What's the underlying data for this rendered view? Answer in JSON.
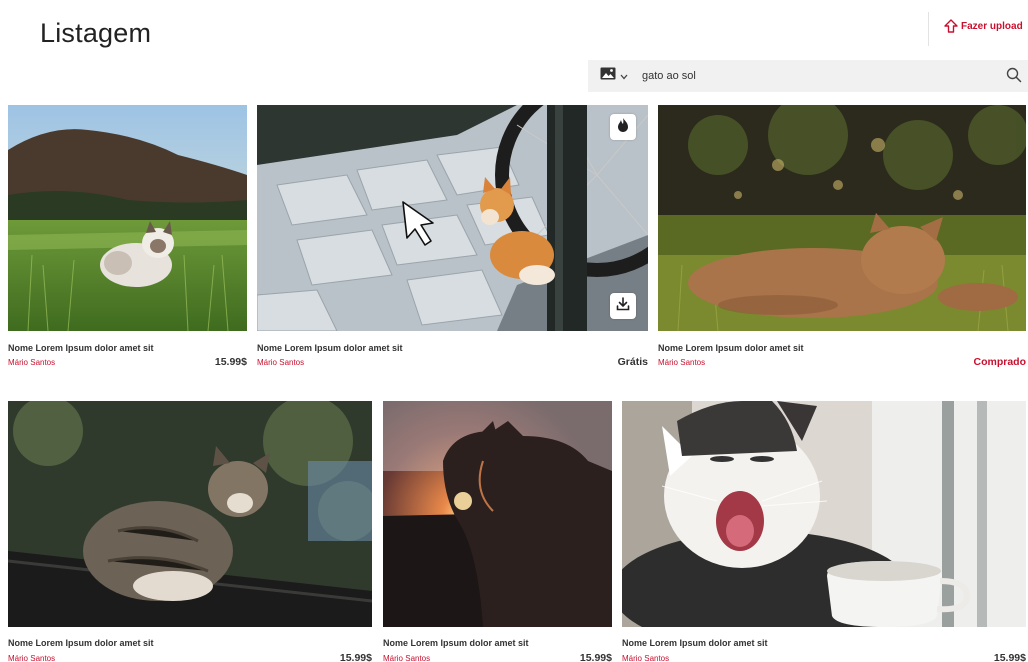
{
  "page": {
    "title": "Listagem"
  },
  "header": {
    "upload_label": "Fazer upload"
  },
  "search": {
    "query": "gato ao sol",
    "type_icon": "image-icon"
  },
  "colors": {
    "accent": "#c8102e",
    "search_bg": "#f1f1f1"
  },
  "items": [
    {
      "name": "Nome Lorem Ipsum dolor amet sit",
      "author": "Mário Santos",
      "price": "15.99$"
    },
    {
      "name": "Nome Lorem Ipsum dolor amet sit",
      "author": "Mário Santos",
      "price": "Grátis"
    },
    {
      "name": "Nome Lorem Ipsum dolor amet sit",
      "author": "Mário Santos",
      "price": "Comprado"
    },
    {
      "name": "Nome Lorem Ipsum dolor amet sit",
      "author": "Mário Santos",
      "price": "15.99$"
    },
    {
      "name": "Nome Lorem Ipsum dolor amet sit",
      "author": "Mário Santos",
      "price": "15.99$"
    },
    {
      "name": "Nome Lorem Ipsum dolor amet sit",
      "author": "Mário Santos",
      "price": "15.99$"
    }
  ]
}
